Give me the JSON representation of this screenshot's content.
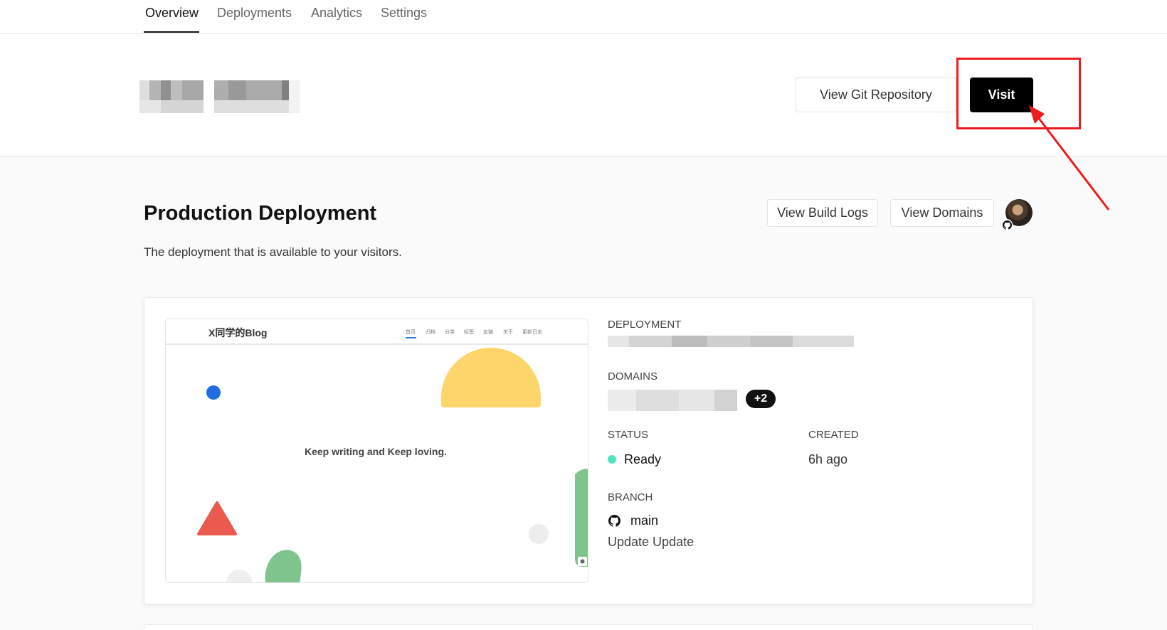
{
  "tabs": [
    {
      "label": "Overview",
      "active": true
    },
    {
      "label": "Deployments",
      "active": false
    },
    {
      "label": "Analytics",
      "active": false
    },
    {
      "label": "Settings",
      "active": false
    }
  ],
  "header": {
    "view_git_label": "View Git Repository",
    "visit_label": "Visit"
  },
  "production": {
    "title": "Production Deployment",
    "subtitle": "The deployment that is available to your visitors.",
    "view_build_logs_label": "View Build Logs",
    "view_domains_label": "View Domains"
  },
  "preview": {
    "blog_title": "X同学的Blog",
    "nav_items": [
      "首页",
      "归档",
      "分类",
      "标签",
      "友链",
      "关于",
      "更新日志"
    ],
    "tagline": "Keep writing and Keep loving."
  },
  "details": {
    "deployment_label": "DEPLOYMENT",
    "domains_label": "DOMAINS",
    "domains_extra": "+2",
    "status_label": "STATUS",
    "status_value": "Ready",
    "created_label": "CREATED",
    "created_value": "6h ago",
    "branch_label": "BRANCH",
    "branch_value": "main",
    "commit_message": "Update Update"
  },
  "colors": {
    "accent": "#000000",
    "status_ready": "#50e3c2",
    "annotation": "#ee1c1c"
  }
}
